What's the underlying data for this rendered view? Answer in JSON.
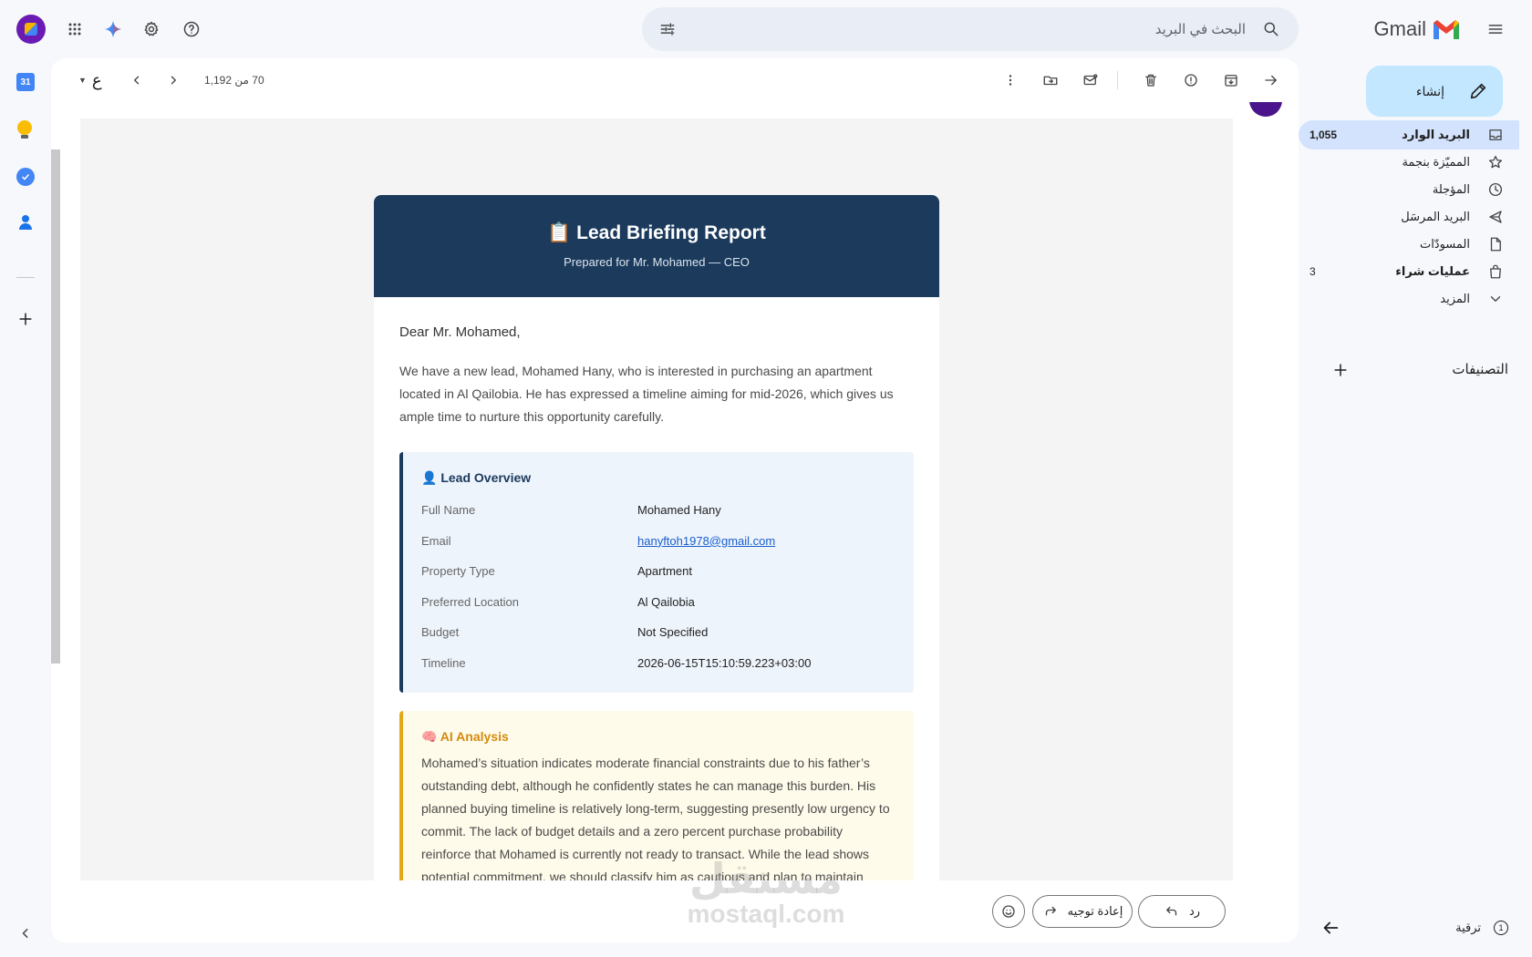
{
  "app": {
    "name": "Gmail"
  },
  "search": {
    "placeholder": "البحث في البريد"
  },
  "compose": {
    "label": "إنشاء"
  },
  "nav": {
    "items": [
      {
        "label": "البريد الوارد",
        "count": "1,055",
        "icon": "inbox-icon",
        "active": true
      },
      {
        "label": "المميّزة بنجمة",
        "count": "",
        "icon": "star-icon"
      },
      {
        "label": "المؤجلة",
        "count": "",
        "icon": "clock-icon"
      },
      {
        "label": "البريد المرسَل",
        "count": "",
        "icon": "send-icon"
      },
      {
        "label": "المسودّات",
        "count": "",
        "icon": "draft-icon"
      },
      {
        "label": "عمليات شراء",
        "count": "3",
        "icon": "bag-icon",
        "bold": true
      },
      {
        "label": "المزيد",
        "count": "",
        "icon": "chevron-down-icon"
      }
    ],
    "labels_heading": "التصنيفات",
    "upgrade": "ترقية"
  },
  "toolbar": {
    "pagination": "70 من 1,192",
    "input_tool": "ع"
  },
  "report": {
    "title": "📋 Lead Briefing Report",
    "subtitle": "Prepared for Mr. Mohamed — CEO",
    "greeting": "Dear Mr. Mohamed,",
    "intro": "We have a new lead, Mohamed Hany, who is interested in purchasing an apartment located in Al Qailobia. He has expressed a timeline aiming for mid-2026, which gives us ample time to nurture this opportunity carefully.",
    "overview_title": "👤 Lead Overview",
    "overview": [
      {
        "k": "Full Name",
        "v": "Mohamed Hany"
      },
      {
        "k": "Email",
        "v": "hanyftoh1978@gmail.com",
        "link": true
      },
      {
        "k": "Property Type",
        "v": "Apartment"
      },
      {
        "k": "Preferred Location",
        "v": "Al Qailobia"
      },
      {
        "k": "Budget",
        "v": "Not Specified"
      },
      {
        "k": "Timeline",
        "v": "2026-06-15T15:10:59.223+03:00"
      }
    ],
    "ai_title": "🧠 AI Analysis",
    "ai_text": "Mohamed’s situation indicates moderate financial constraints due to his father’s outstanding debt, although he confidently states he can manage this burden. His planned buying timeline is relatively long-term, suggesting presently low urgency to commit. The lack of budget details and a zero percent purchase probability reinforce that Mohamed is currently not ready to transact. While the lead shows potential commitment, we should classify him as cautious and plan to maintain engagement over time."
  },
  "actions": {
    "reply": "رد",
    "forward": "إعادة توجيه"
  },
  "watermark": {
    "arabic": "مستقل",
    "latin": "mostaql.com"
  },
  "colors": {
    "header": "#1b3a5c",
    "accent_ai": "#e2a81b",
    "active_nav": "#d3e3fd"
  }
}
